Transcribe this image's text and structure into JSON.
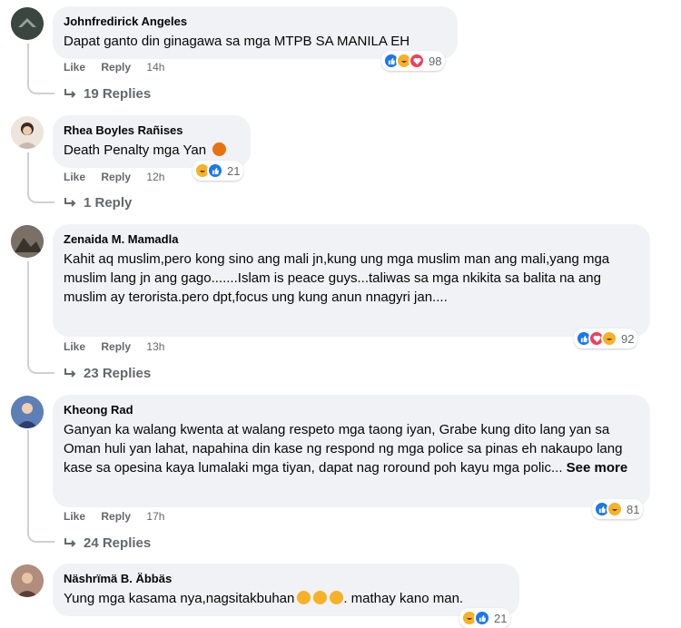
{
  "colors": {
    "like": "#1877f2",
    "haha": "#f7b125",
    "love": "#f33e58",
    "angry": "#e9710f",
    "meta": "#65676b",
    "bubble": "#f0f2f5"
  },
  "actions": {
    "like": "Like",
    "reply": "Reply"
  },
  "comments": [
    {
      "author": "Johnfredirick Angeles",
      "text": "Dapat ganto din ginagawa sa mga MTPB SA MANILA EH",
      "time": "14h",
      "reactions": [
        "like",
        "haha",
        "love"
      ],
      "count": "98",
      "replies": "19 Replies"
    },
    {
      "author": "Rhea Boyles Rañises",
      "text": "Death Penalty mga Yan",
      "emoji": "angry-face-emoji",
      "time": "12h",
      "reactions": [
        "haha",
        "like"
      ],
      "count": "21",
      "replies": "1 Reply"
    },
    {
      "author": "Zenaida M. Mamadla",
      "text": "Kahit aq muslim,pero kong sino ang mali jn,kung ung mga muslim man ang mali,yang mga muslim lang jn ang gago.......Islam is peace guys...taliwas sa mga nkikita sa balita na ang muslim ay terorista.pero dpt,focus ung kung anun nnagyri jan....",
      "time": "13h",
      "reactions": [
        "like",
        "love",
        "haha"
      ],
      "count": "92",
      "replies": "23 Replies"
    },
    {
      "author": "Kheong Rad",
      "text": "Ganyan ka walang kwenta at walang respeto mga taong iyan, Grabe kung dito lang yan sa Oman huli yan lahat, napahina din kase ng respond ng mga police sa pinas eh nakaupo lang kase sa opesina kaya lumalaki mga tiyan, dapat nag roround poh kayu mga polic...",
      "see_more": "See more",
      "time": "17h",
      "reactions": [
        "like",
        "haha"
      ],
      "count": "81",
      "replies": "24 Replies"
    },
    {
      "author": "Näshrïmä B. Äbbäs",
      "text": "Yung mga kasama nya,nagsitakbuhan",
      "text_end": ". mathay kano man.",
      "emoji": "laughing-emoji",
      "time": "",
      "reactions": [
        "haha",
        "like"
      ],
      "count": "21",
      "replies": ""
    }
  ]
}
